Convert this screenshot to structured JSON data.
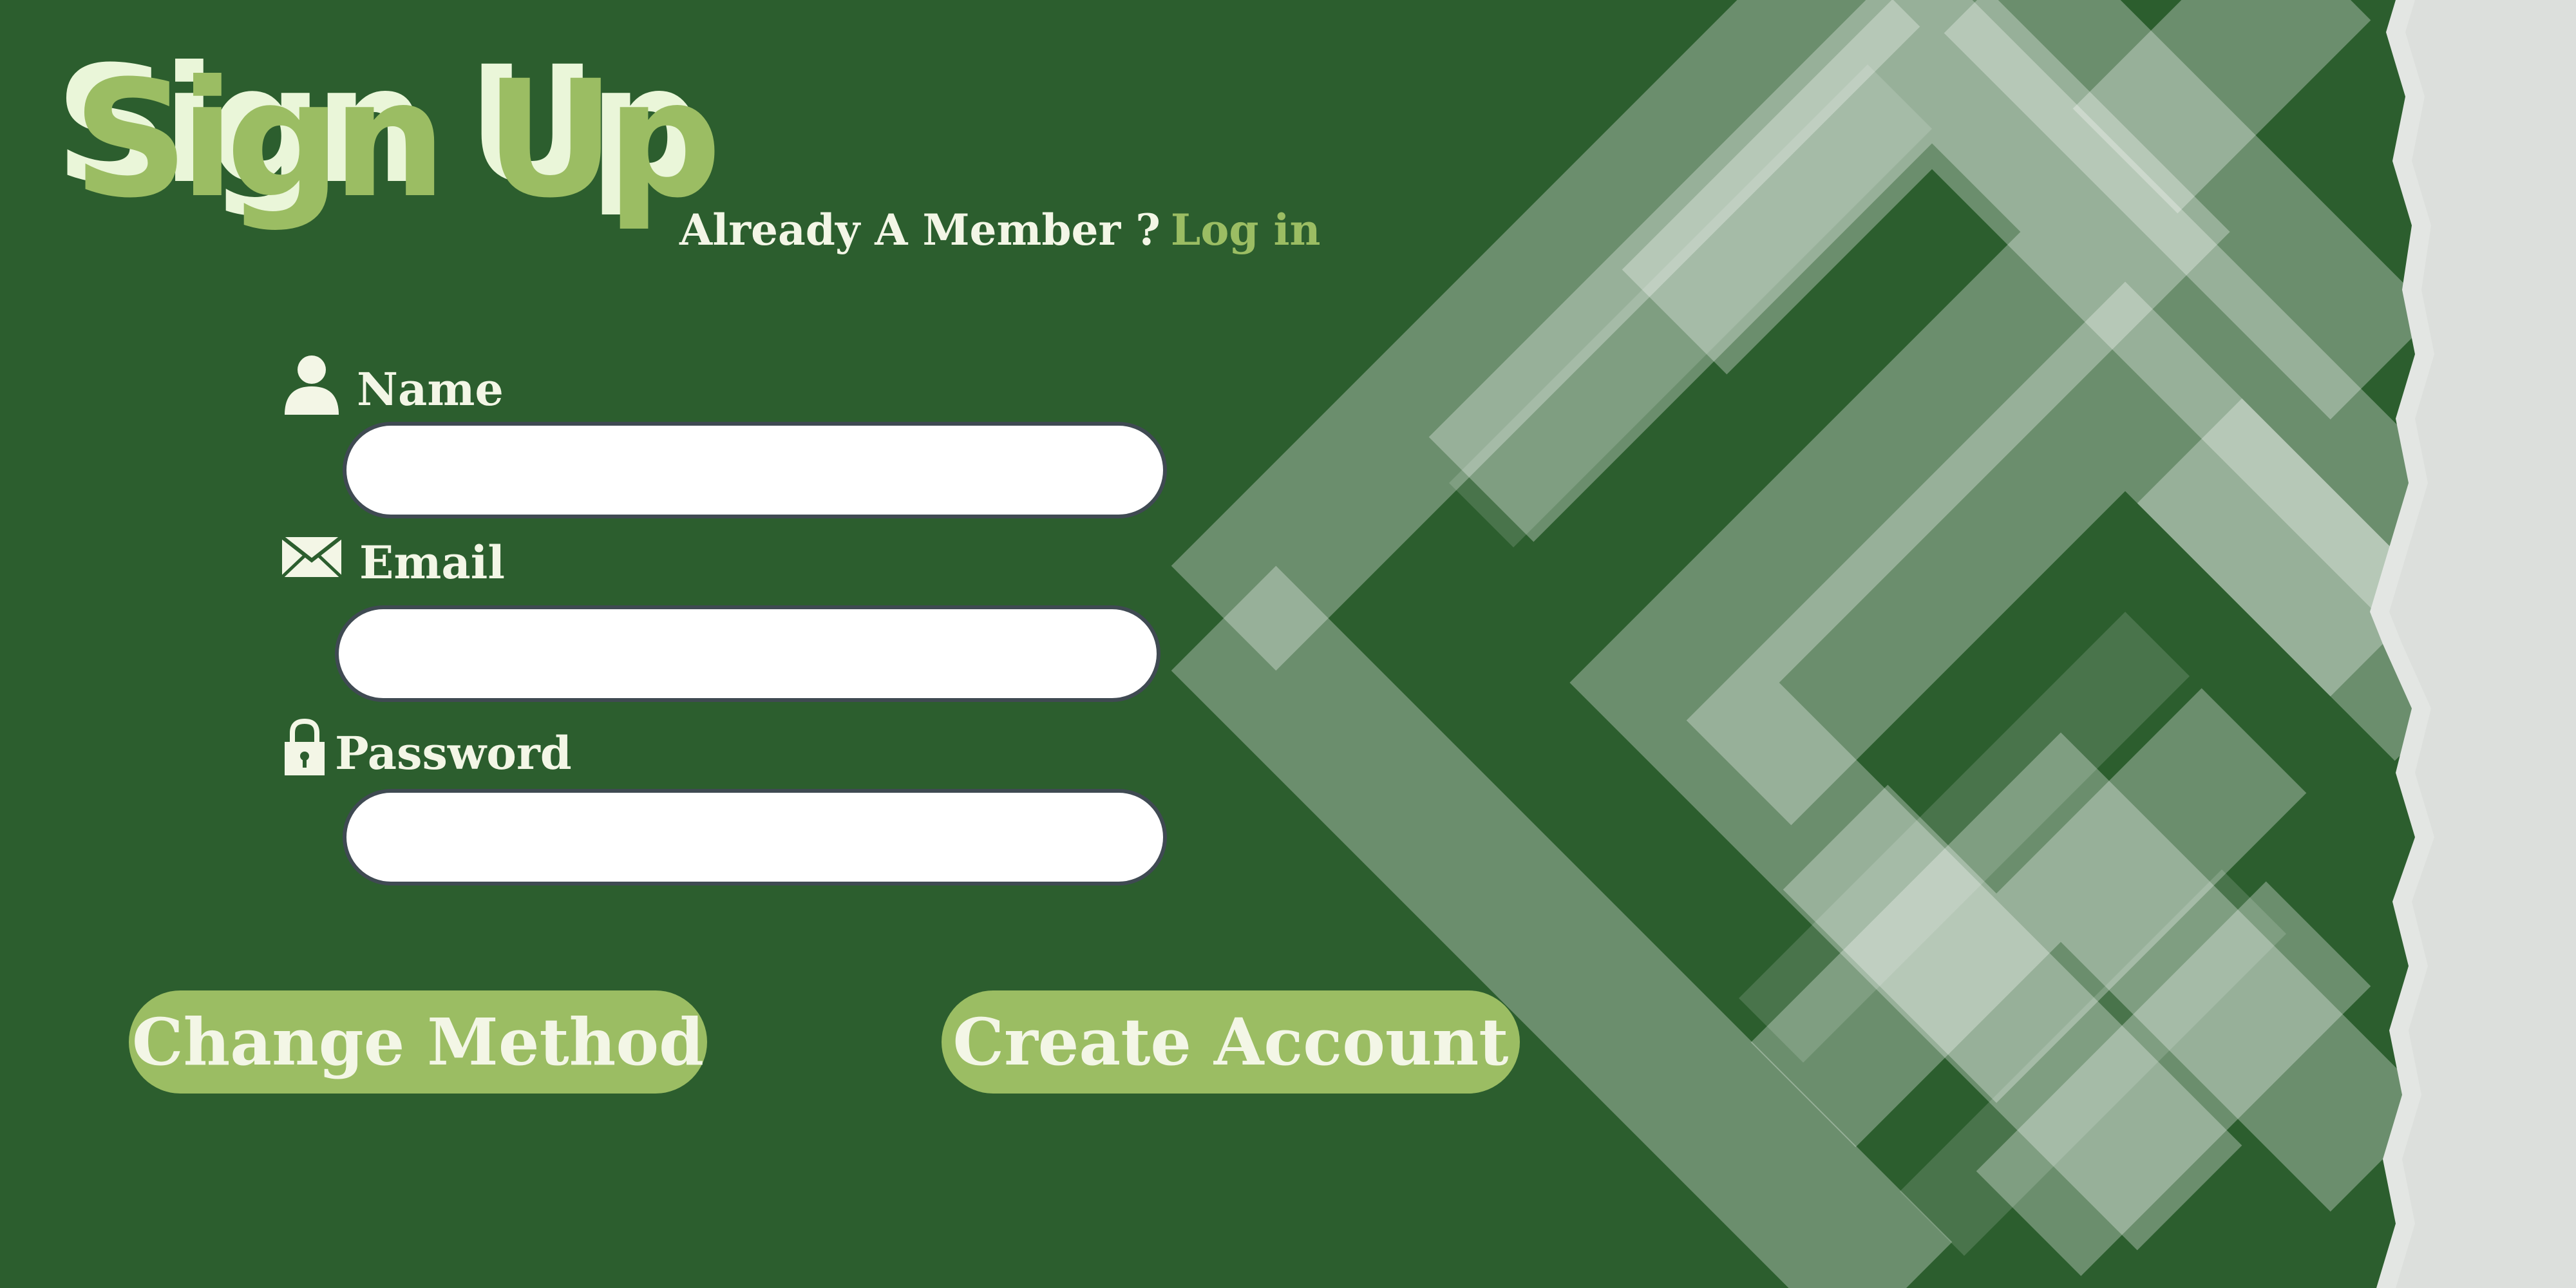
{
  "header": {
    "title": "Sign Up",
    "member_prompt": "Already A Member  ?",
    "login_link": "Log  in"
  },
  "form": {
    "name": {
      "label": "Name",
      "icon": "user-icon",
      "value": ""
    },
    "email": {
      "label": "Email",
      "icon": "envelope-icon",
      "value": ""
    },
    "password": {
      "label": "Password",
      "icon": "lock-icon",
      "value": ""
    }
  },
  "actions": {
    "change_method": "Change Method",
    "create_account": "Create Account"
  },
  "colors": {
    "background": "#2c5e2e",
    "accent": "#9bbd63",
    "text_light": "#f3f6e6",
    "field_border": "#3f4a52"
  }
}
